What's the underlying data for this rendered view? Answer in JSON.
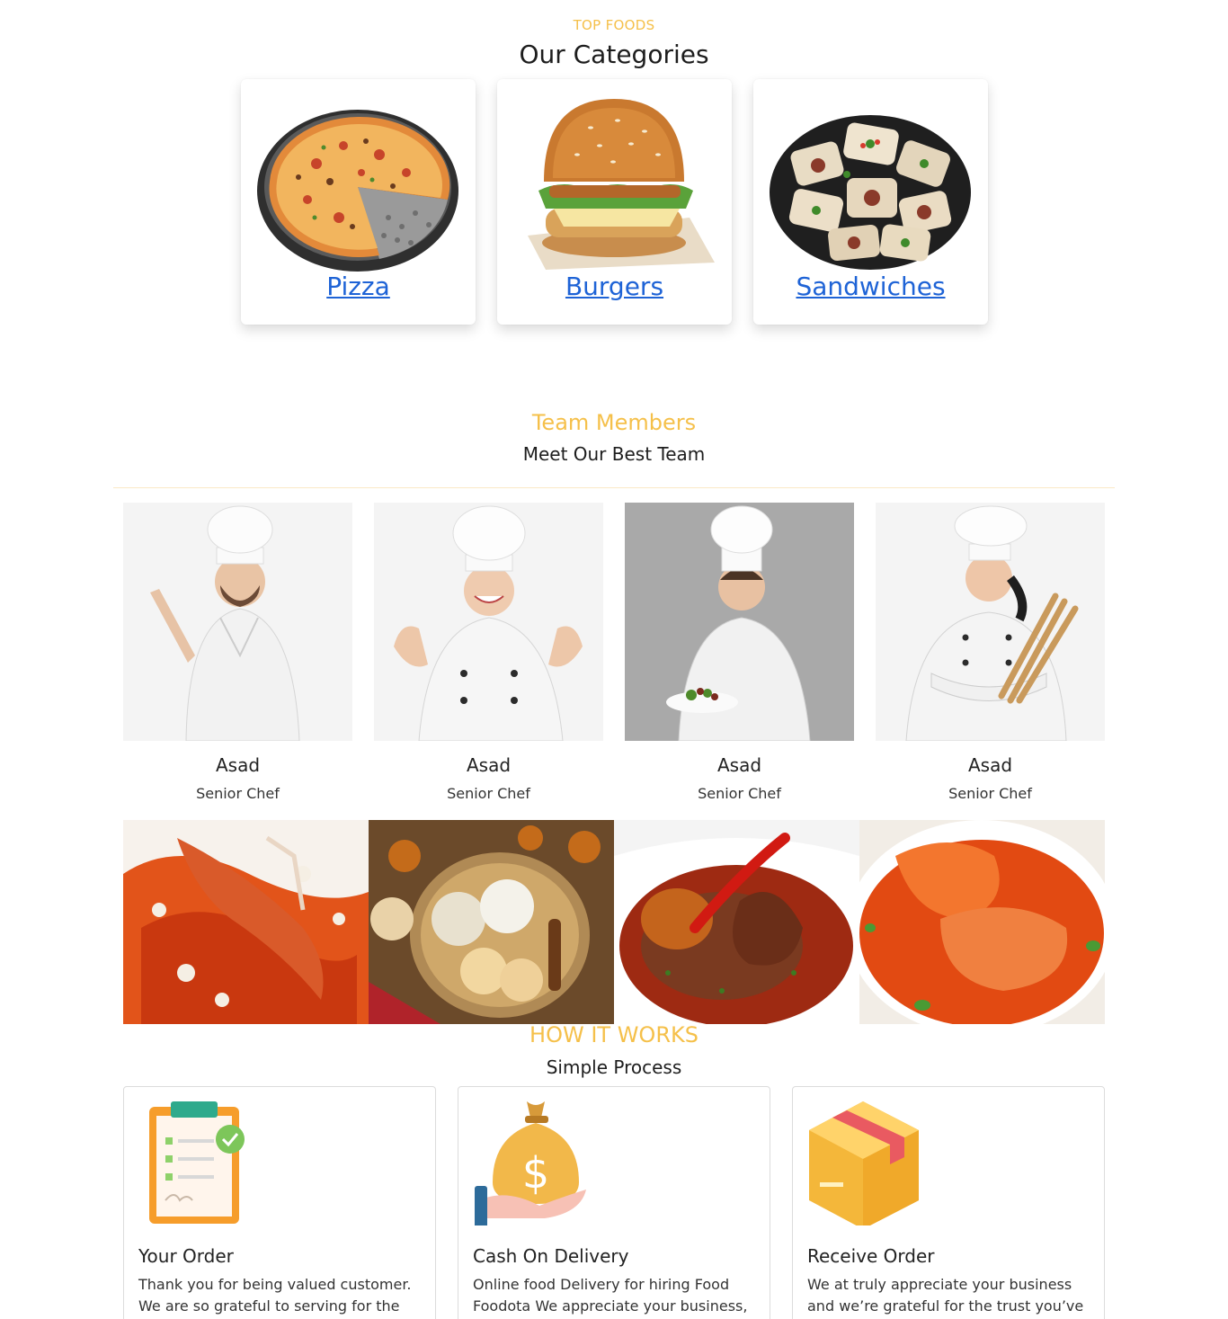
{
  "categories": {
    "eyebrow": "TOP FOODS",
    "title": "Our Categories",
    "items": [
      {
        "label": "Pizza"
      },
      {
        "label": "Burgers"
      },
      {
        "label": "Sandwiches"
      }
    ]
  },
  "team": {
    "eyebrow": "Team Members",
    "title": "Meet Our Best Team",
    "members": [
      {
        "name": "Asad",
        "role": "Senior Chef"
      },
      {
        "name": "Asad",
        "role": "Senior Chef"
      },
      {
        "name": "Asad",
        "role": "Senior Chef"
      },
      {
        "name": "Asad",
        "role": "Senior Chef"
      }
    ]
  },
  "how": {
    "eyebrow": "HOW IT WORKS",
    "title": "Simple Process",
    "steps": [
      {
        "title": "Your Order",
        "text": "Thank you for being valued customer. We are so grateful to serving for the",
        "icon": "clipboard-check-icon"
      },
      {
        "title": "Cash On Delivery",
        "text": "Online food Delivery for hiring Food Foodota We appreciate your business,",
        "icon": "money-bag-icon"
      },
      {
        "title": "Receive Order",
        "text": "We at truly appreciate your business and we’re grateful for the trust you’ve",
        "icon": "box-icon"
      }
    ]
  },
  "colors": {
    "accent": "#f5c04a",
    "link": "#1e63d6"
  }
}
